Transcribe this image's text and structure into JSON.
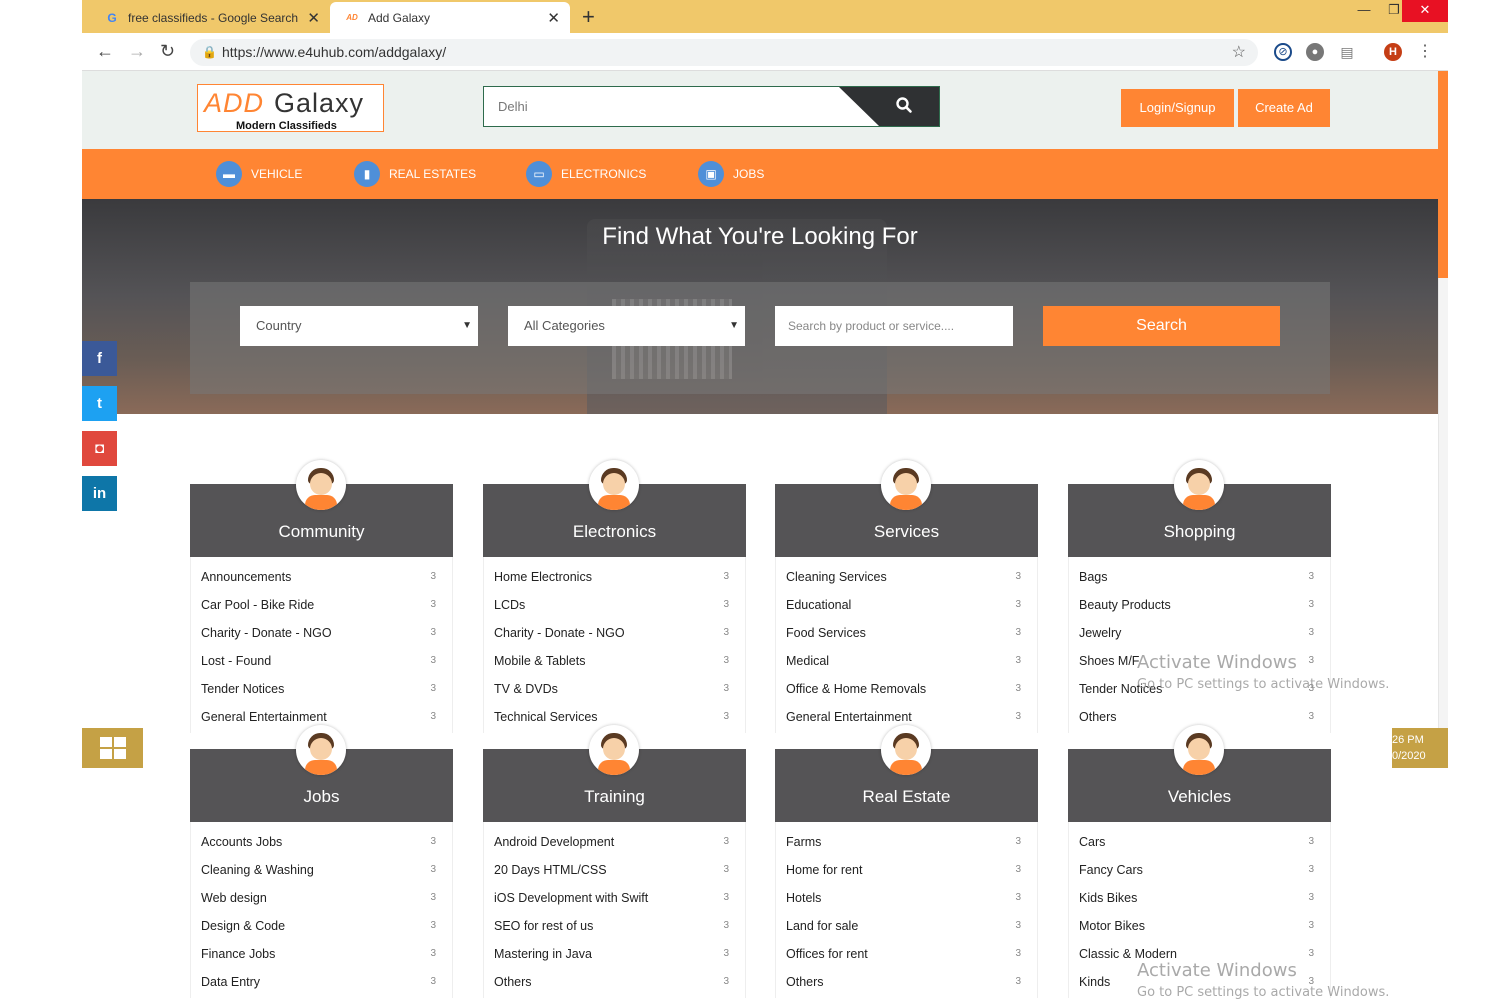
{
  "browser": {
    "tabs": [
      {
        "label": "free classifieds - Google Search",
        "active": false
      },
      {
        "label": "Add Galaxy",
        "active": true
      }
    ],
    "new_tab": "+",
    "url": "https://www.e4uhub.com/addgalaxy/",
    "window_controls": {
      "minimize": "—",
      "maximize": "❐",
      "close": "✕"
    },
    "profile_initial": "H"
  },
  "header": {
    "logo": {
      "part1": "ADD",
      "part2": "Galaxy",
      "tagline": "Modern Classifieds"
    },
    "search_value": "Delhi",
    "login_label": "Login/Signup",
    "create_label": "Create Ad"
  },
  "nav": [
    {
      "label": "VEHICLE",
      "icon": "truck-icon"
    },
    {
      "label": "REAL ESTATES",
      "icon": "building-icon"
    },
    {
      "label": "ELECTRONICS",
      "icon": "monitor-icon"
    },
    {
      "label": "JOBS",
      "icon": "briefcase-icon"
    }
  ],
  "hero": {
    "title": "Find What You're Looking For",
    "country": "Country",
    "categories": "All Categories",
    "query_placeholder": "Search by product or service....",
    "search_label": "Search"
  },
  "social": {
    "facebook": "f",
    "twitter": "t",
    "instagram": "◘",
    "linkedin": "in"
  },
  "cards": [
    {
      "title": "Community",
      "items": [
        {
          "label": "Announcements",
          "count": "3"
        },
        {
          "label": "Car Pool - Bike Ride",
          "count": "3"
        },
        {
          "label": "Charity - Donate - NGO",
          "count": "3"
        },
        {
          "label": "Lost - Found",
          "count": "3"
        },
        {
          "label": "Tender Notices",
          "count": "3"
        },
        {
          "label": "General Entertainment",
          "count": "3"
        }
      ]
    },
    {
      "title": "Electronics",
      "items": [
        {
          "label": "Home Electronics",
          "count": "3"
        },
        {
          "label": "LCDs",
          "count": "3"
        },
        {
          "label": "Charity - Donate - NGO",
          "count": "3"
        },
        {
          "label": "Mobile & Tablets",
          "count": "3"
        },
        {
          "label": "TV & DVDs",
          "count": "3"
        },
        {
          "label": "Technical Services",
          "count": "3"
        }
      ]
    },
    {
      "title": "Services",
      "items": [
        {
          "label": "Cleaning Services",
          "count": "3"
        },
        {
          "label": "Educational",
          "count": "3"
        },
        {
          "label": "Food Services",
          "count": "3"
        },
        {
          "label": "Medical",
          "count": "3"
        },
        {
          "label": "Office & Home Removals",
          "count": "3"
        },
        {
          "label": "General Entertainment",
          "count": "3"
        }
      ]
    },
    {
      "title": "Shopping",
      "items": [
        {
          "label": "Bags",
          "count": "3"
        },
        {
          "label": "Beauty Products",
          "count": "3"
        },
        {
          "label": "Jewelry",
          "count": "3"
        },
        {
          "label": "Shoes M/F",
          "count": "3"
        },
        {
          "label": "Tender Notices",
          "count": "3"
        },
        {
          "label": "Others",
          "count": "3"
        }
      ]
    },
    {
      "title": "Jobs",
      "items": [
        {
          "label": "Accounts Jobs",
          "count": "3"
        },
        {
          "label": "Cleaning & Washing",
          "count": "3"
        },
        {
          "label": "Web design",
          "count": "3"
        },
        {
          "label": "Design & Code",
          "count": "3"
        },
        {
          "label": "Finance Jobs",
          "count": "3"
        },
        {
          "label": "Data Entry",
          "count": "3"
        }
      ]
    },
    {
      "title": "Training",
      "items": [
        {
          "label": "Android Development",
          "count": "3"
        },
        {
          "label": "20 Days HTML/CSS",
          "count": "3"
        },
        {
          "label": "iOS Development with Swift",
          "count": "3"
        },
        {
          "label": "SEO for rest of us",
          "count": "3"
        },
        {
          "label": "Mastering in Java",
          "count": "3"
        },
        {
          "label": "Others",
          "count": "3"
        }
      ]
    },
    {
      "title": "Real Estate",
      "items": [
        {
          "label": "Farms",
          "count": "3"
        },
        {
          "label": "Home for rent",
          "count": "3"
        },
        {
          "label": "Hotels",
          "count": "3"
        },
        {
          "label": "Land for sale",
          "count": "3"
        },
        {
          "label": "Offices for rent",
          "count": "3"
        },
        {
          "label": "Others",
          "count": "3"
        }
      ]
    },
    {
      "title": "Vehicles",
      "items": [
        {
          "label": "Cars",
          "count": "3"
        },
        {
          "label": "Fancy Cars",
          "count": "3"
        },
        {
          "label": "Kids Bikes",
          "count": "3"
        },
        {
          "label": "Motor Bikes",
          "count": "3"
        },
        {
          "label": "Classic & Modern",
          "count": "3"
        },
        {
          "label": "Kinds",
          "count": "3"
        }
      ]
    }
  ],
  "windows": {
    "activate_title": "Activate Windows",
    "activate_sub": "Go to PC settings to activate Windows.",
    "clock_time": "26 PM",
    "clock_date": "0/2020"
  },
  "colors": {
    "accent": "#ff8533",
    "card_header": "#555456",
    "nav_icon": "#4f8fd8"
  }
}
